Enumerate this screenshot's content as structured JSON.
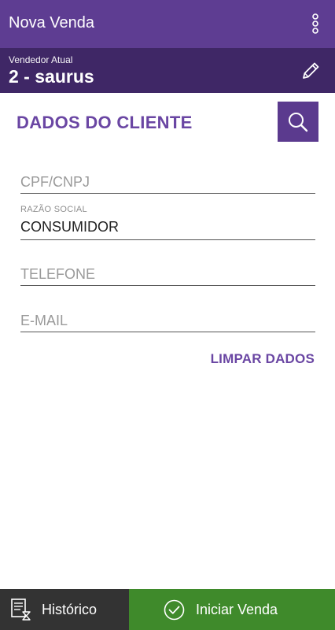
{
  "appbar": {
    "title": "Nova Venda"
  },
  "seller": {
    "label": "Vendedor Atual",
    "name": "2 - saurus"
  },
  "customer_section": {
    "title": "DADOS DO CLIENTE",
    "fields": {
      "cpf": {
        "placeholder": "CPF/CNPJ",
        "value": ""
      },
      "razao_social": {
        "label": "RAZÃO SOCIAL",
        "value": "CONSUMIDOR"
      },
      "telefone": {
        "placeholder": "TELEFONE",
        "value": ""
      },
      "email": {
        "placeholder": "E-MAIL",
        "value": ""
      }
    },
    "clear_label": "LIMPAR DADOS"
  },
  "bottom": {
    "history_label": "Histórico",
    "start_label": "Iniciar Venda"
  },
  "colors": {
    "appbar": "#5e3d92",
    "seller_bar": "#3f2766",
    "accent": "#6a46a3",
    "history_bg": "#333333",
    "start_bg": "#3f8a2b"
  },
  "icons": [
    "overflow-menu-icon",
    "pencil-icon",
    "search-icon",
    "history-icon",
    "check-circle-icon"
  ]
}
